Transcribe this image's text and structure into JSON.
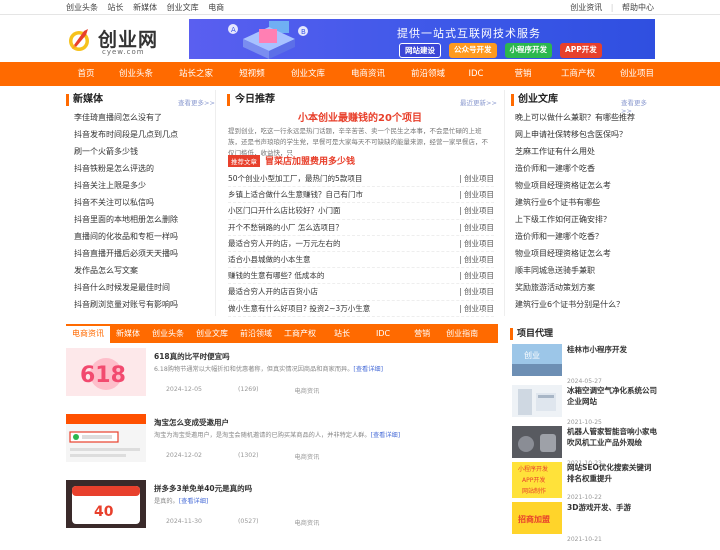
{
  "topbar": {
    "left": [
      "创业头条",
      "站长",
      "新媒体",
      "创业文库",
      "电商"
    ],
    "right": [
      "创业资讯",
      "帮助中心"
    ]
  },
  "logo": {
    "name": "创业网",
    "domain": "cyew.com"
  },
  "banner": {
    "title": "提供一站式互联网技术服务",
    "pills": [
      {
        "label": "网站建设",
        "color": "#3b46d6"
      },
      {
        "label": "公众号开发",
        "color": "#ff9a1f"
      },
      {
        "label": "小程序开发",
        "color": "#2cb84e"
      },
      {
        "label": "APP开发",
        "color": "#e8402c"
      }
    ]
  },
  "nav": [
    "首页",
    "创业头条",
    "站长之家",
    "短视频",
    "创业文库",
    "电商资讯",
    "前沿领域",
    "IDC",
    "营销",
    "工商产权",
    "创业项目"
  ],
  "media": {
    "title": "新媒体",
    "more": "查看更多>>",
    "items": [
      "李佳琦直播间怎么没有了",
      "抖音发布时间段是几点到几点",
      "刷一个火箭多少钱",
      "抖音铁粉是怎么评选的",
      "抖音关注上限是多少",
      "抖音不关注可以私信吗",
      "抖音里面的本地相册怎么删除",
      "直播间的化妆品和专柜一样吗",
      "抖音直播开播后必须天天播吗",
      "发作品怎么写文案",
      "抖音什么时候发是最佳时间",
      "抖音刷浏览量对账号有影响吗"
    ]
  },
  "today": {
    "title": "今日推荐",
    "more": "最近更新>>",
    "headline": "小本创业最赚钱的20个项目",
    "intro": "提到创业，吃这一行永远是热门话题，辛辛苦苦、卖一个民生之本事，不会是忙碌的上班族，还是书声琅琅的学生党，早餐可是大家每天不可缺缺的能量来源，经营一家早餐店，不仅门槛低，收益快，只",
    "rec_tag": "推荐文章",
    "rec_title": "冒菜店加盟费用多少钱",
    "items": [
      {
        "title": "50个创业小型加工厂，最热门的5款项目",
        "cat": "创业项目"
      },
      {
        "title": "乡镇上适合做什么生意赚钱？自己有门市",
        "cat": "创业项目"
      },
      {
        "title": "小区门口开什么店比较好？小门面",
        "cat": "创业项目"
      },
      {
        "title": "开个不愁销路的小厂 怎么选项目？",
        "cat": "创业项目"
      },
      {
        "title": "最适合穷人开的店，一万元左右的",
        "cat": "创业项目"
      },
      {
        "title": "适合小县城做的小本生意",
        "cat": "创业项目"
      },
      {
        "title": "赚钱的生意有哪些? 低成本的",
        "cat": "创业项目"
      },
      {
        "title": "最适合穷人开的店百货小店",
        "cat": "创业项目"
      },
      {
        "title": "做小生意有什么好项目? 投资2~3万小生意",
        "cat": "创业项目"
      }
    ]
  },
  "library": {
    "title": "创业文库",
    "more": "查看更多>>",
    "items": [
      "晚上可以做什么兼职？有哪些推荐",
      "网上申请社保转移包含医保吗？",
      "芝麻工作证有什么用处",
      "造价师和一建哪个吃香",
      "物业项目经理资格证怎么考",
      "建筑行业6个证书有哪些",
      "上下级工作如何正确安排？",
      "造价师和一建哪个吃香？",
      "物业项目经理资格证怎么考",
      "顺丰同城急送骑手兼职",
      "奖励旅游活动策划方案",
      "建筑行业6个证书分别是什么？"
    ]
  },
  "tabs": [
    "电商资讯",
    "新媒体",
    "创业头条",
    "创业文库",
    "前沿领域",
    "工商产权",
    "站长",
    "IDC",
    "营销",
    "创业指南"
  ],
  "news": [
    {
      "title": "618真的比平时便宜吗",
      "desc": "6.18购物节通常以大幅折扣和优惠著称，但真实情况因商品和商家而异。",
      "detail": "[查看详细]",
      "date": "2024-12-05",
      "views": "(1269)",
      "cat": "电商资讯"
    },
    {
      "title": "淘宝怎么变成受邀用户",
      "desc": "淘宝为淘宝受邀用户，是淘宝会随机邀请的已购买某商品的人，并非特定人群。",
      "detail": "[查看详细]",
      "date": "2024-12-02",
      "views": "(1302)",
      "cat": "电商资讯"
    },
    {
      "title": "拼多多3单免单40元是真的吗",
      "desc": "是真的。",
      "detail": "[查看详细]",
      "date": "2024-11-30",
      "views": "(0527)",
      "cat": "电商资讯"
    }
  ],
  "agent": {
    "title": "项目代理",
    "items": [
      {
        "title": "桂林市小程序开发",
        "date": "2024-05-27"
      },
      {
        "title": "冰箱空调空气净化系统公司企业网站",
        "date": "2021-10-25"
      },
      {
        "title": "机器人管家智能音响小家电吹风机工业产品外观绘",
        "date": "2021-10-23"
      },
      {
        "title": "网站SEO优化搜索关键词排名权重提升",
        "date": "2021-10-22"
      },
      {
        "title": "3D游戏开发、手游",
        "date": "2021-10-21"
      }
    ],
    "thumb_texts": [
      "创业",
      "小程序开发",
      "APP开发",
      "网站制作",
      "招商加盟"
    ]
  }
}
